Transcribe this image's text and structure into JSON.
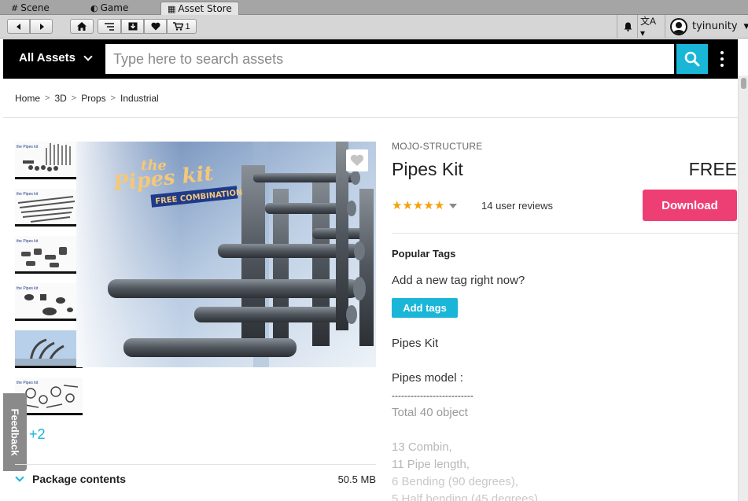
{
  "editor_tabs": [
    {
      "label": "Scene",
      "icon": "grid-icon"
    },
    {
      "label": "Game",
      "icon": "pacman-icon"
    },
    {
      "label": "Asset Store",
      "icon": "store-icon"
    }
  ],
  "toolbar": {
    "cart_count": "1",
    "username": "tyinunity"
  },
  "search": {
    "category_label": "All Assets",
    "placeholder": "Type here to search assets"
  },
  "breadcrumb": [
    "Home",
    "3D",
    "Props",
    "Industrial"
  ],
  "gallery": {
    "more_count": "+2",
    "banner_line1": "the",
    "banner_line2": "Pipes kit",
    "banner_ribbon": "FREE COMBINATION"
  },
  "feedback_label": "Feedback",
  "package": {
    "contents_label": "Package contents",
    "size": "50.5 MB"
  },
  "product": {
    "publisher": "MOJO-STRUCTURE",
    "title": "Pipes Kit",
    "price": "FREE",
    "rating": 5,
    "reviews": "14 user reviews",
    "download_label": "Download",
    "popular_tags_label": "Popular Tags",
    "add_tag_prompt": "Add a new tag right now?",
    "add_tags_label": "Add tags",
    "description": [
      "Pipes Kit",
      "",
      "Pipes model :",
      "--------------------------",
      "Total 40 object",
      "",
      "13 Combin,",
      "11 Pipe length,",
      "6 Bending (90 degrees),",
      "5 Half bending (45 degrees)"
    ]
  },
  "colors": {
    "accent": "#19b6d8",
    "download": "#ee3f75",
    "star": "#f5a10a"
  }
}
